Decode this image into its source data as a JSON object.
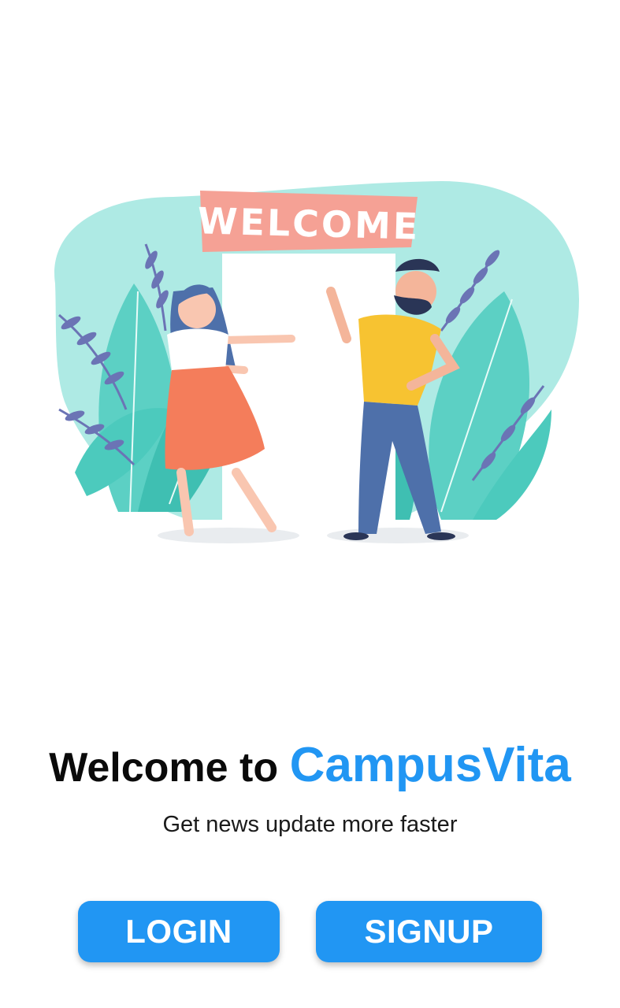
{
  "illustration": {
    "sign_text": "WELCOME"
  },
  "headline": {
    "lead": "Welcome to ",
    "brand": "CampusVita"
  },
  "subtitle": "Get news update more faster",
  "buttons": {
    "login_label": "LOGIN",
    "signup_label": "SIGNUP"
  },
  "colors": {
    "accent": "#2196f3",
    "background": "#ffffff",
    "blob": "#aeeae4",
    "sign": "#f5a195"
  }
}
